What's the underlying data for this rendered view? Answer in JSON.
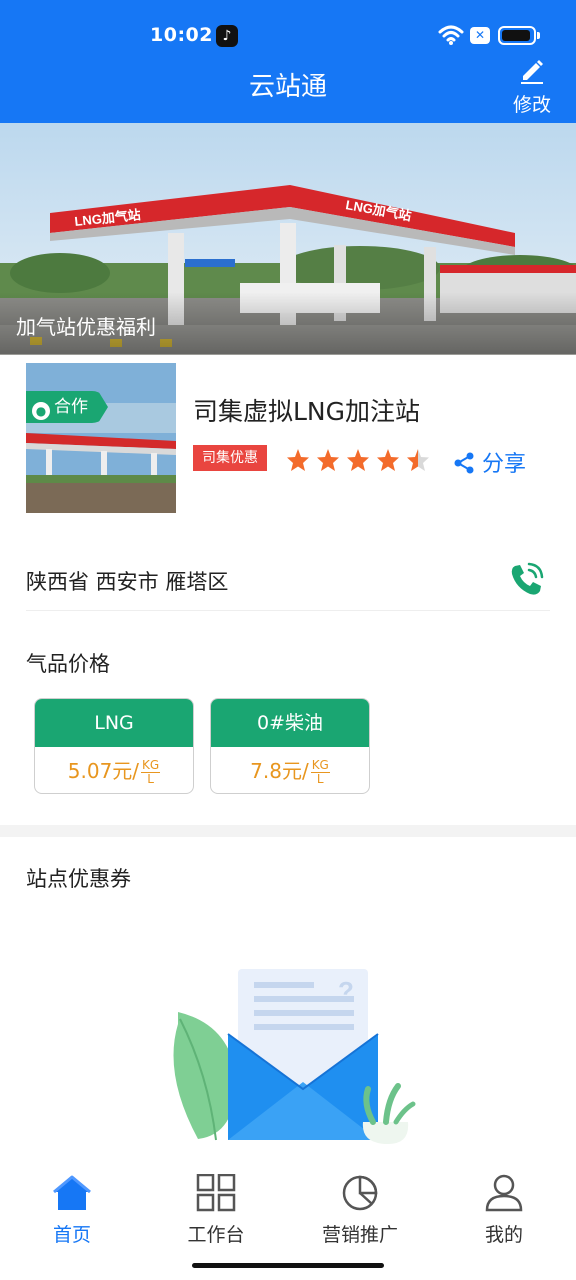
{
  "status_bar": {
    "time": "10:02"
  },
  "header": {
    "title": "云站通",
    "edit_label": "修改"
  },
  "banner": {
    "caption": "加气站优惠福利",
    "sign_text": "LNG加气站"
  },
  "station": {
    "badge": "合作",
    "name": "司集虚拟LNG加注站",
    "promo_tag": "司集优惠",
    "rating": 4.5,
    "rating_max": 5,
    "share_label": "分享",
    "address": "陕西省 西安市 雁塔区"
  },
  "prices": {
    "title": "气品价格",
    "items": [
      {
        "name": "LNG",
        "value": "5.07元/",
        "unit_top": "KG",
        "unit_bottom": "L"
      },
      {
        "name": "0#柴油",
        "value": "7.8元/",
        "unit_top": "KG",
        "unit_bottom": "L"
      }
    ]
  },
  "coupons": {
    "title": "站点优惠券"
  },
  "tabbar": {
    "items": [
      {
        "label": "首页",
        "icon": "home-icon",
        "active": true
      },
      {
        "label": "工作台",
        "icon": "grid-icon",
        "active": false
      },
      {
        "label": "营销推广",
        "icon": "pie-chart-icon",
        "active": false
      },
      {
        "label": "我的",
        "icon": "user-icon",
        "active": false
      }
    ]
  },
  "colors": {
    "primary": "#1677f5",
    "green": "#1aa672",
    "orange": "#e8961f",
    "red": "#e9453f",
    "star": "#f36b2b"
  }
}
